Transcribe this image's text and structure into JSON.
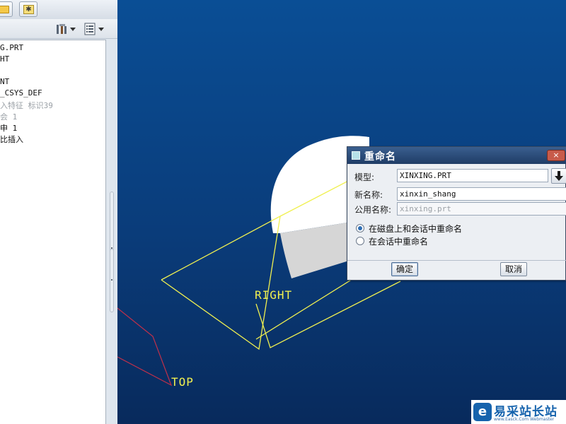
{
  "model_tree": {
    "items": [
      {
        "label": "G.PRT",
        "muted": false
      },
      {
        "label": "HT",
        "muted": false
      },
      {
        "label": "NT",
        "muted": false
      },
      {
        "label": "_CSYS_DEF",
        "muted": false
      },
      {
        "label": "入特征 标识39",
        "muted": true
      },
      {
        "label": "会 1",
        "muted": true
      },
      {
        "label": "申 1",
        "muted": false
      },
      {
        "label": "比插入",
        "muted": false
      }
    ]
  },
  "viewport": {
    "labels": {
      "right": "RIGHT",
      "top": "TOP"
    },
    "colors": {
      "background": "#0a4580",
      "datum_plane": "#f0f050",
      "top_plane": "#c0304a",
      "part": "#ffffff"
    }
  },
  "rename_dialog": {
    "title": "重命名",
    "close_label": "×",
    "model_label": "模型:",
    "model_value": "XINXING.PRT",
    "new_name_label": "新名称:",
    "new_name_value": "xinxin_shang",
    "common_name_label": "公用名称:",
    "common_name_value": "xinxing.prt",
    "options": [
      {
        "label": "在磁盘上和会话中重命名",
        "checked": true
      },
      {
        "label": "在会话中重命名",
        "checked": false
      }
    ],
    "ok_label": "确定",
    "cancel_label": "取消"
  },
  "watermark": {
    "logo_glyph": "e",
    "text": "易采站长站",
    "sub": "www.Easck.Com Webmaster"
  }
}
